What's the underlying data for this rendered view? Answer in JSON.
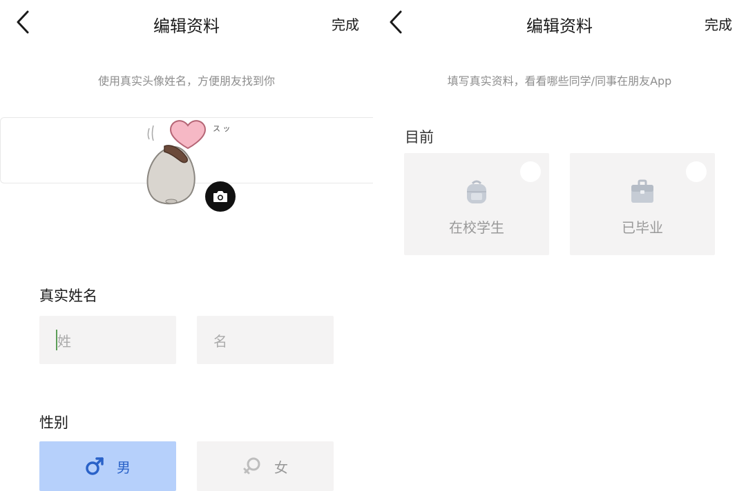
{
  "left_screen": {
    "title": "编辑资料",
    "done_label": "完成",
    "hint": "使用真实头像姓名，方便朋友找到你",
    "avatar_caption": "ス ッ",
    "name_section": {
      "label": "真实姓名",
      "surname_placeholder": "姓",
      "given_placeholder": "名"
    },
    "gender_section": {
      "label": "性别",
      "male_label": "男",
      "female_label": "女",
      "selected": "男",
      "selected_color": "#b6d0fb"
    }
  },
  "right_screen": {
    "title": "编辑资料",
    "done_label": "完成",
    "hint": "填写真实资料，看看哪些同学/同事在朋友App",
    "current_label": "目前",
    "options": [
      {
        "label": "在校学生",
        "icon": "backpack-icon"
      },
      {
        "label": "已毕业",
        "icon": "briefcase-icon"
      }
    ]
  },
  "colors": {
    "accent_selected_bg": "#b6d0fb",
    "accent_selected_text": "#2a62c8",
    "card_bg": "#f4f3f3",
    "hint_text": "#8d8d8d",
    "caret": "#5c9e58"
  }
}
